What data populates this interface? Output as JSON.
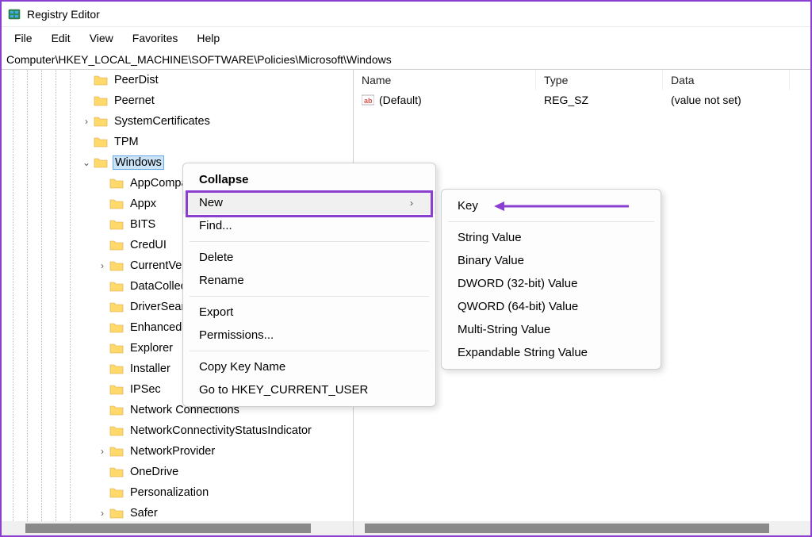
{
  "window": {
    "title": "Registry Editor"
  },
  "menu": {
    "file": "File",
    "edit": "Edit",
    "view": "View",
    "favorites": "Favorites",
    "help": "Help"
  },
  "address": {
    "path": "Computer\\HKEY_LOCAL_MACHINE\\SOFTWARE\\Policies\\Microsoft\\Windows"
  },
  "tree": {
    "items": [
      {
        "indent": 5,
        "chev": "",
        "label": "PeerDist"
      },
      {
        "indent": 5,
        "chev": "",
        "label": "Peernet"
      },
      {
        "indent": 5,
        "chev": "›",
        "label": "SystemCertificates"
      },
      {
        "indent": 5,
        "chev": "",
        "label": "TPM"
      },
      {
        "indent": 5,
        "chev": "⌄",
        "label": "Windows",
        "selected": true
      },
      {
        "indent": 6,
        "chev": "",
        "label": "AppCompat"
      },
      {
        "indent": 6,
        "chev": "",
        "label": "Appx"
      },
      {
        "indent": 6,
        "chev": "",
        "label": "BITS"
      },
      {
        "indent": 6,
        "chev": "",
        "label": "CredUI"
      },
      {
        "indent": 6,
        "chev": "›",
        "label": "CurrentVersion"
      },
      {
        "indent": 6,
        "chev": "",
        "label": "DataCollection"
      },
      {
        "indent": 6,
        "chev": "",
        "label": "DriverSearching"
      },
      {
        "indent": 6,
        "chev": "",
        "label": "EnhancedStorageDevices"
      },
      {
        "indent": 6,
        "chev": "",
        "label": "Explorer"
      },
      {
        "indent": 6,
        "chev": "",
        "label": "Installer"
      },
      {
        "indent": 6,
        "chev": "",
        "label": "IPSec"
      },
      {
        "indent": 6,
        "chev": "",
        "label": "Network Connections"
      },
      {
        "indent": 6,
        "chev": "",
        "label": "NetworkConnectivityStatusIndicator"
      },
      {
        "indent": 6,
        "chev": "›",
        "label": "NetworkProvider"
      },
      {
        "indent": 6,
        "chev": "",
        "label": "OneDrive"
      },
      {
        "indent": 6,
        "chev": "",
        "label": "Personalization"
      },
      {
        "indent": 6,
        "chev": "›",
        "label": "Safer"
      }
    ]
  },
  "list": {
    "columns": {
      "name": "Name",
      "type": "Type",
      "data": "Data"
    },
    "rows": [
      {
        "name": "(Default)",
        "type": "REG_SZ",
        "data": "(value not set)"
      }
    ]
  },
  "ctx1": {
    "collapse": "Collapse",
    "new": "New",
    "find": "Find...",
    "delete": "Delete",
    "rename": "Rename",
    "export": "Export",
    "permissions": "Permissions...",
    "copy_key_name": "Copy Key Name",
    "goto_hkcu": "Go to HKEY_CURRENT_USER"
  },
  "ctx2": {
    "key": "Key",
    "string": "String Value",
    "binary": "Binary Value",
    "dword": "DWORD (32-bit) Value",
    "qword": "QWORD (64-bit) Value",
    "multi": "Multi-String Value",
    "expand": "Expandable String Value"
  }
}
